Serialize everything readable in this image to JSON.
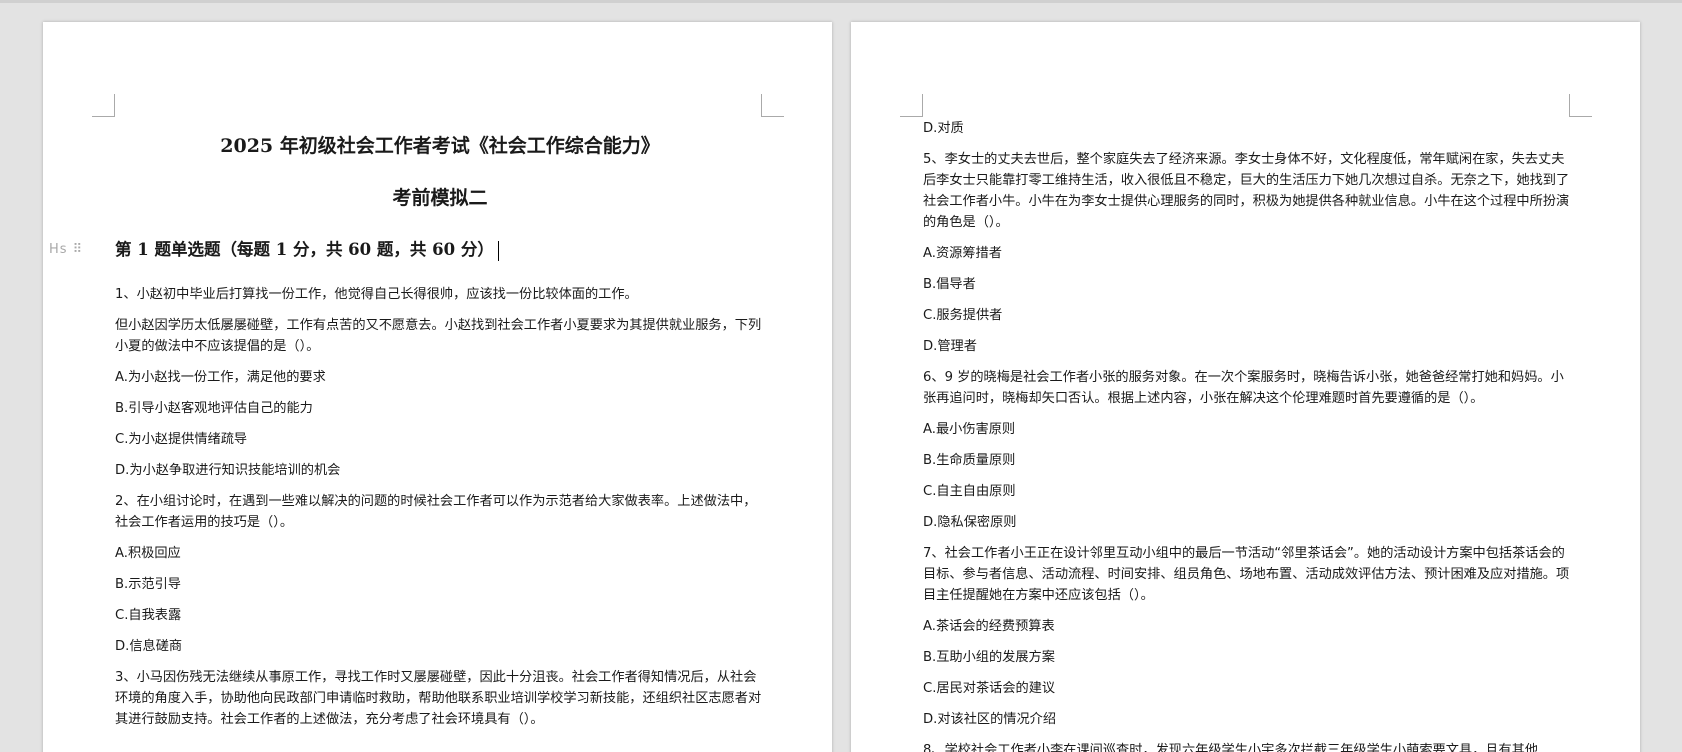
{
  "left_page": {
    "title": "2025 年初级社会工作者考试《社会工作综合能力》",
    "subtitle": "考前模拟二",
    "heading_handle": "Hs ⠿",
    "section_heading": "第 1 题单选题（每题 1 分，共 60 题，共 60 分）",
    "q1_line1": "1、小赵初中毕业后打算找一份工作，他觉得自己长得很帅，应该找一份比较体面的工作。",
    "q1_line2": "但小赵因学历太低屡屡碰壁，工作有点苦的又不愿意去。小赵找到社会工作者小夏要求为其提供就业服务，下列小夏的做法中不应该提倡的是（）。",
    "q1_options": [
      "A.为小赵找一份工作，满足他的要求",
      "B.引导小赵客观地评估自己的能力",
      "C.为小赵提供情绪疏导",
      "D.为小赵争取进行知识技能培训的机会"
    ],
    "q2_text": "2、在小组讨论时，在遇到一些难以解决的问题的时候社会工作者可以作为示范者给大家做表率。上述做法中，社会工作者运用的技巧是（）。",
    "q2_options": [
      "A.积极回应",
      "B.示范引导",
      "C.自我表露",
      "D.信息磋商"
    ],
    "q3_text": "3、小马因伤残无法继续从事原工作，寻找工作时又屡屡碰壁，因此十分沮丧。社会工作者得知情况后，从社会环境的角度入手，协助他向民政部门申请临时救助，帮助他联系职业培训学校学习新技能，还组织社区志愿者对其进行鼓励支持。社会工作者的上述做法，充分考虑了社会环境具有（）。"
  },
  "right_page": {
    "q4_last_option": "D.对质",
    "q5_text": "5、李女士的丈夫去世后，整个家庭失去了经济来源。李女士身体不好，文化程度低，常年赋闲在家，失去丈夫后李女士只能靠打零工维持生活，收入很低且不稳定，巨大的生活压力下她几次想过自杀。无奈之下，她找到了社会工作者小牛。小牛在为李女士提供心理服务的同时，积极为她提供各种就业信息。小牛在这个过程中所扮演的角色是（）。",
    "q5_options": [
      "A.资源筹措者",
      "B.倡导者",
      "C.服务提供者",
      "D.管理者"
    ],
    "q6_text": "6、9 岁的晓梅是社会工作者小张的服务对象。在一次个案服务时，晓梅告诉小张，她爸爸经常打她和妈妈。小张再追问时，晓梅却矢口否认。根据上述内容，小张在解决这个伦理难题时首先要遵循的是（）。",
    "q6_options": [
      "A.最小伤害原则",
      "B.生命质量原则",
      "C.自主自由原则",
      "D.隐私保密原则"
    ],
    "q7_text": "7、社会工作者小王正在设计邻里互动小组中的最后一节活动“邻里茶话会”。她的活动设计方案中包括茶话会的目标、参与者信息、活动流程、时间安排、组员角色、场地布置、活动成效评估方法、预计困难及应对措施。项目主任提醒她在方案中还应该包括（）。",
    "q7_options": [
      "A.茶话会的经费预算表",
      "B.互助小组的发展方案",
      "C.居民对茶话会的建议",
      "D.对该社区的情况介绍"
    ],
    "q8_text": "8、学校社会工作者小李在课间巡查时，发现六年级学生小宇多次拦截三年级学生小萌索要文具，且有其他"
  }
}
